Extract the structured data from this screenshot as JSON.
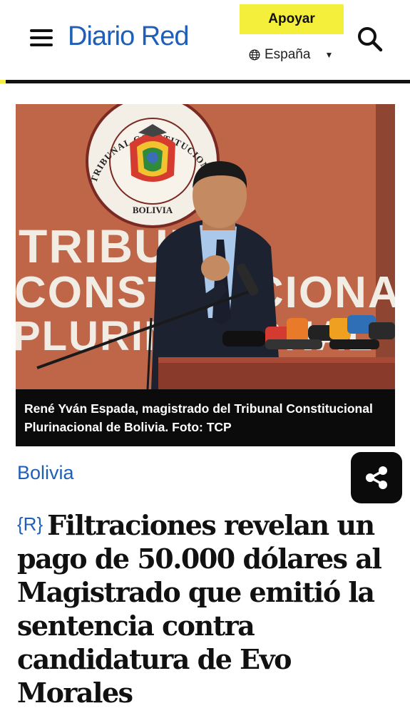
{
  "header": {
    "logo": "Diario Red",
    "support_label": "Apoyar",
    "region_label": "España",
    "colors": {
      "brand": "#1f5fb8",
      "accent": "#f3ef3a"
    },
    "icons": [
      "menu-icon",
      "globe-icon",
      "caret-down-icon",
      "search-icon"
    ]
  },
  "photo": {
    "seal_text_top": "TRIBUNAL CONSTITUCIONAL PLURINACIONAL",
    "seal_text_bottom": "BOLIVIA",
    "wall_lines": [
      "TRIBUNAL",
      "CONSTITUCIONAL",
      "PLURINACIONAL"
    ]
  },
  "article": {
    "caption": "René Yván Espada, magistrado del Tribunal Constitucional Plurinacional de Bolivia. Foto: TCP",
    "category": "Bolivia",
    "badge": "{R}",
    "headline": "Filtraciones revelan un pago de 50.000 dólares al Magistrado que emitió la sentencia contra candidatura de Evo Morales",
    "share_icon": "share-icon"
  }
}
